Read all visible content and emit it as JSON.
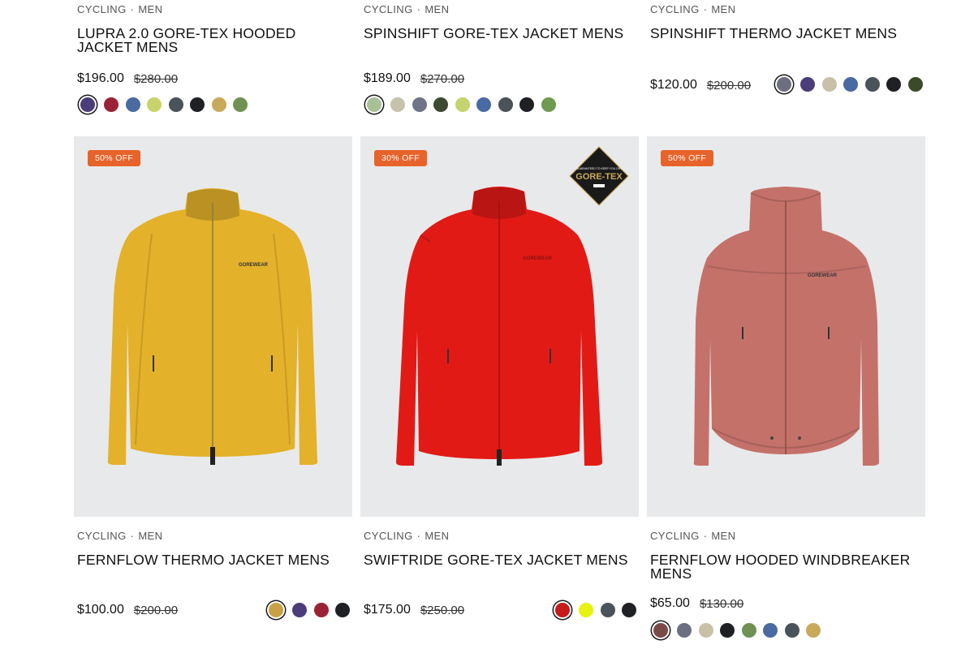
{
  "products_top": [
    {
      "category": "CYCLING",
      "gender": "MEN",
      "title": "LUPRA 2.0 GORE-TEX HOODED JACKET MENS",
      "price": "$196.00",
      "old_price": "$280.00",
      "swatches": [
        "#4b3d7a",
        "#9b2236",
        "#4a6aa0",
        "#c8d36a",
        "#4a525a",
        "#1f2024",
        "#c9a95a",
        "#6f9254"
      ],
      "selected_swatch": 0
    },
    {
      "category": "CYCLING",
      "gender": "MEN",
      "title": "SPINSHIFT GORE-TEX JACKET MENS",
      "price": "$189.00",
      "old_price": "$270.00",
      "swatches": [
        "#a8c096",
        "#c7c2ab",
        "#6f7488",
        "#3b4a30",
        "#c4d46e",
        "#4a6aa0",
        "#4a525a",
        "#1f2024",
        "#6f9a50"
      ],
      "selected_swatch": 0
    },
    {
      "category": "CYCLING",
      "gender": "MEN",
      "title": "SPINSHIFT THERMO JACKET MENS",
      "price": "$120.00",
      "old_price": "$200.00",
      "swatches": [
        "#6b6f80",
        "#4b3d7a",
        "#c9c0a8",
        "#4a6aa0",
        "#4a525a",
        "#1f2024",
        "#3d4a2a"
      ],
      "selected_swatch": 0
    }
  ],
  "products_bottom": [
    {
      "badge": "50% OFF",
      "category": "CYCLING",
      "gender": "MEN",
      "title": "FERNFLOW THERMO JACKET MENS",
      "price": "$100.00",
      "old_price": "$200.00",
      "jacket_color": "#e3b12a",
      "swatches": [
        "#c9a044",
        "#4b3d7a",
        "#9b2236",
        "#1f2024"
      ],
      "selected_swatch": 0
    },
    {
      "badge": "30% OFF",
      "gtx_label": "GORE-TEX",
      "gtx_guarantee": "GUARANTEED TO KEEP YOU DRY",
      "category": "CYCLING",
      "gender": "MEN",
      "title": "SWIFTRIDE GORE-TEX JACKET MENS",
      "price": "$175.00",
      "old_price": "$250.00",
      "jacket_color": "#e21a16",
      "swatches": [
        "#c71a1a",
        "#e8f20f",
        "#4a525a",
        "#1f2024"
      ],
      "selected_swatch": 0
    },
    {
      "badge": "50% OFF",
      "category": "CYCLING",
      "gender": "MEN",
      "title": "FERNFLOW HOODED WINDBREAKER MENS",
      "price": "$65.00",
      "old_price": "$130.00",
      "jacket_color": "#c4716a",
      "swatches": [
        "#7a4a48",
        "#6b6f80",
        "#c9c0a8",
        "#1f2024",
        "#6f9254",
        "#4a6aa0",
        "#4a525a",
        "#c9a95a"
      ],
      "selected_swatch": 0
    }
  ],
  "separator": "·",
  "brand_print": "GOREWEAR"
}
